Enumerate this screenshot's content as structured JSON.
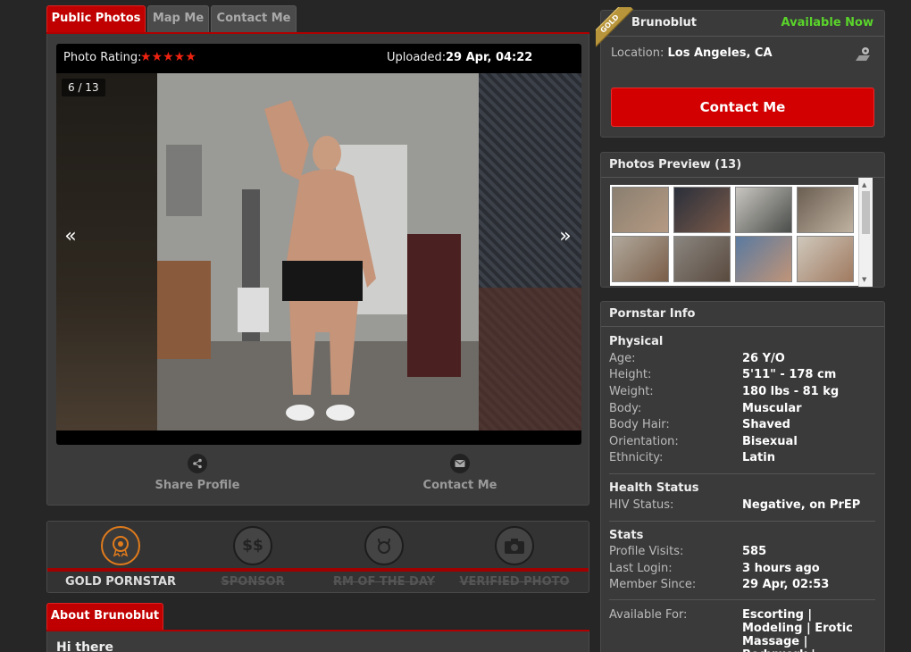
{
  "tabs": {
    "public_photos": "Public Photos",
    "map_me": "Map Me",
    "contact_me": "Contact Me"
  },
  "viewer": {
    "rating_label": "Photo Rating:",
    "stars": "★★★★★",
    "uploaded_label": "Uploaded:",
    "uploaded_value": "29 Apr, 04:22",
    "counter": "6 / 13",
    "prev": "«",
    "next": "»"
  },
  "actions": {
    "share": "Share Profile",
    "contact": "Contact Me"
  },
  "badges": [
    {
      "label": "GOLD PORNSTAR",
      "active": true
    },
    {
      "label": "SPONSOR",
      "active": false
    },
    {
      "label": "RM OF THE DAY",
      "active": false
    },
    {
      "label": "VERIFIED PHOTO",
      "active": false
    }
  ],
  "about": {
    "tab": "About Brunoblut",
    "intro": "Hi there"
  },
  "profile": {
    "ribbon": "GOLD",
    "name": "Brunoblut",
    "availability": "Available Now",
    "location_label": "Location:",
    "location": "Los Angeles, CA",
    "contact_button": "Contact Me",
    "availability_color": "#5ad42b"
  },
  "preview": {
    "title": "Photos Preview (13)"
  },
  "info": {
    "title": "Pornstar Info",
    "physical": {
      "heading": "Physical",
      "rows": [
        {
          "k": "Age:",
          "v": "26 Y/O"
        },
        {
          "k": "Height:",
          "v": "5'11\" - 178 cm"
        },
        {
          "k": "Weight:",
          "v": "180 lbs - 81 kg"
        },
        {
          "k": "Body:",
          "v": "Muscular"
        },
        {
          "k": "Body Hair:",
          "v": "Shaved"
        },
        {
          "k": "Orientation:",
          "v": "Bisexual"
        },
        {
          "k": "Ethnicity:",
          "v": "Latin"
        }
      ]
    },
    "health": {
      "heading": "Health Status",
      "rows": [
        {
          "k": "HIV Status:",
          "v": "Negative, on PrEP"
        }
      ]
    },
    "stats": {
      "heading": "Stats",
      "rows": [
        {
          "k": "Profile Visits:",
          "v": "585"
        },
        {
          "k": "Last Login:",
          "v": "3 hours ago"
        },
        {
          "k": "Member Since:",
          "v": "29 Apr, 02:53"
        }
      ]
    },
    "available_for": {
      "k": "Available For:",
      "v": "Escorting | Modeling | Erotic Massage | Bodywork | Available"
    }
  },
  "colors": {
    "accent": "#c00000",
    "background": "#262626",
    "panel": "#3a3a3a"
  }
}
